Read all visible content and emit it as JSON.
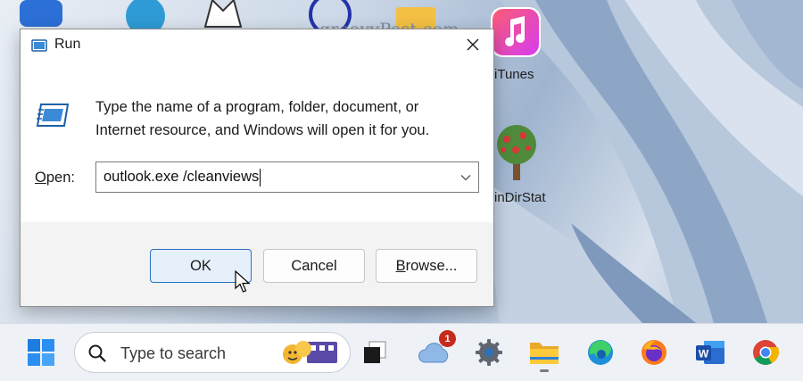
{
  "desktop": {
    "watermark": "groovyPost.com",
    "icons": [
      {
        "name": "itunes-desktop-icon",
        "label": "iTunes"
      },
      {
        "name": "windirstat-desktop-icon",
        "label": "inDirStat"
      }
    ]
  },
  "run_dialog": {
    "title": "Run",
    "description_line1": "Type the name of a program, folder, document, or",
    "description_line2": "Internet resource, and Windows will open it for you.",
    "open_label_mnemonic": "O",
    "open_label_rest": "pen:",
    "open_value": "outlook.exe /cleanviews",
    "ok_label": "OK",
    "cancel_label": "Cancel",
    "browse_label_mnemonic": "B",
    "browse_label_rest": "rowse...",
    "close_icon": "close-icon"
  },
  "taskbar": {
    "search_placeholder": "Type to search",
    "widgets_badge": "1",
    "items": [
      "start-icon",
      "search-icon",
      "task-view-icon",
      "widgets-icon",
      "settings-icon",
      "file-explorer-icon",
      "edge-icon",
      "firefox-icon",
      "word-icon",
      "chrome-icon"
    ]
  },
  "colors": {
    "accent": "#2a6fc4",
    "badge": "#c42b1c",
    "taskbar": "#eef2f7"
  }
}
